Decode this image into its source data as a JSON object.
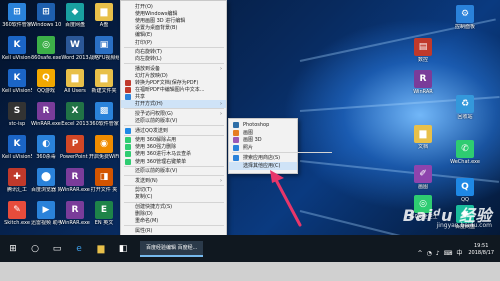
{
  "desktop_icons": [
    {
      "label": "360软件管家",
      "color": "#2a82da",
      "glyph": "⊞",
      "col": 0,
      "row": 0
    },
    {
      "label": "Windows 10",
      "color": "#1e5fae",
      "glyph": "⊞",
      "col": 1,
      "row": 0
    },
    {
      "label": "百度网盘",
      "color": "#19a0a0",
      "glyph": "◆",
      "col": 2,
      "row": 0
    },
    {
      "label": "A盘",
      "color": "#e8c04a",
      "glyph": "▆",
      "col": 3,
      "row": 0
    },
    {
      "label": "Keil uVision4",
      "color": "#1b65c6",
      "glyph": "K",
      "col": 0,
      "row": 1
    },
    {
      "label": "360safe.exe",
      "color": "#3cb048",
      "glyph": "◎",
      "col": 1,
      "row": 1
    },
    {
      "label": "Word 2013",
      "color": "#2b5797",
      "glyph": "W",
      "col": 2,
      "row": 1
    },
    {
      "label": "战略FU视频组件",
      "color": "#2a6fc4",
      "glyph": "▣",
      "col": 3,
      "row": 1
    },
    {
      "label": "Keil uVision5",
      "color": "#1b65c6",
      "glyph": "K",
      "col": 0,
      "row": 2
    },
    {
      "label": "QQ游戏",
      "color": "#f2a800",
      "glyph": "Q",
      "col": 1,
      "row": 2
    },
    {
      "label": "All Users",
      "color": "#e8c04a",
      "glyph": "▆",
      "col": 2,
      "row": 2
    },
    {
      "label": "新建文件夹",
      "color": "#e8c04a",
      "glyph": "▆",
      "col": 3,
      "row": 2
    },
    {
      "label": "stc-isp",
      "color": "#333",
      "glyph": "S",
      "col": 0,
      "row": 3
    },
    {
      "label": "WinRAR.exe 快捷方式",
      "color": "#7a3c9a",
      "glyph": "R",
      "col": 1,
      "row": 3
    },
    {
      "label": "Excel 2013",
      "color": "#217346",
      "glyph": "X",
      "col": 2,
      "row": 3
    },
    {
      "label": "360软件管家",
      "color": "#2a82da",
      "glyph": "▩",
      "col": 3,
      "row": 3
    },
    {
      "label": "Keil uVision5",
      "color": "#1b65c6",
      "glyph": "K",
      "col": 0,
      "row": 4
    },
    {
      "label": "360杀毒",
      "color": "#2a82da",
      "glyph": "◐",
      "col": 1,
      "row": 4
    },
    {
      "label": "PowerPoint 2013",
      "color": "#d24726",
      "glyph": "P",
      "col": 2,
      "row": 4
    },
    {
      "label": "开启免费WiFi",
      "color": "#f08c00",
      "glyph": "◉",
      "col": 3,
      "row": 4
    },
    {
      "label": "腾讯汇工",
      "color": "#c0392b",
      "glyph": "✚",
      "col": 0,
      "row": 5
    },
    {
      "label": "百度浏览器 好好工具",
      "color": "#2a82da",
      "glyph": "⬤",
      "col": 1,
      "row": 5
    },
    {
      "label": "WinRAR.exe 快捷方式",
      "color": "#7a3c9a",
      "glyph": "R",
      "col": 2,
      "row": 5
    },
    {
      "label": "打开文件 夹",
      "color": "#d35400",
      "glyph": "◨",
      "col": 3,
      "row": 5
    },
    {
      "label": "Skitch.exe",
      "color": "#e74c3c",
      "glyph": "✎",
      "col": 0,
      "row": 6
    },
    {
      "label": "迅雷视频 助手",
      "color": "#2a82da",
      "glyph": "▶",
      "col": 1,
      "row": 6
    },
    {
      "label": "WinRAR.exe 快捷方式",
      "color": "#7a3c9a",
      "glyph": "R",
      "col": 2,
      "row": 6
    },
    {
      "label": "EN 英文",
      "color": "#1e8449",
      "glyph": "E",
      "col": 3,
      "row": 6
    }
  ],
  "right_icons": [
    {
      "label": "控制面板",
      "color": "#2a82da",
      "glyph": "⚙",
      "pos": 0
    },
    {
      "label": "数控",
      "color": "#c0392b",
      "glyph": "▤",
      "pos": 1
    },
    {
      "label": "WinRAR",
      "color": "#7a3c9a",
      "glyph": "R",
      "pos": 2
    },
    {
      "label": "回收站",
      "color": "#3498db",
      "glyph": "♻",
      "pos": 3
    },
    {
      "label": "文档",
      "color": "#e8c04a",
      "glyph": "▆",
      "pos": 4
    },
    {
      "label": "WeChat.exe",
      "color": "#2ecc71",
      "glyph": "✆",
      "pos": 5
    },
    {
      "label": "画图",
      "color": "#8e44ad",
      "glyph": "✐",
      "pos": 6
    },
    {
      "label": "QQ",
      "color": "#1e88e5",
      "glyph": "Q",
      "pos": 7
    },
    {
      "label": "360安全卫士",
      "color": "#2ecc71",
      "glyph": "◎",
      "pos": 8
    },
    {
      "label": "百度网盘",
      "color": "#1abc9c",
      "glyph": "◆",
      "pos": 9
    }
  ],
  "context_menu": [
    {
      "type": "item",
      "label": "打开(O)",
      "icon_color": ""
    },
    {
      "type": "item",
      "label": "使用Windows编辑",
      "icon_color": ""
    },
    {
      "type": "item",
      "label": "使用画图 3D 进行编辑",
      "icon_color": ""
    },
    {
      "type": "item",
      "label": "设置为桌面背景(B)",
      "icon_color": ""
    },
    {
      "type": "item",
      "label": "编辑(E)",
      "icon_color": ""
    },
    {
      "type": "item",
      "label": "打印(P)",
      "icon_color": ""
    },
    {
      "type": "sep"
    },
    {
      "type": "item",
      "label": "向右旋转(T)",
      "icon_color": ""
    },
    {
      "type": "item",
      "label": "向左旋转(L)",
      "icon_color": ""
    },
    {
      "type": "sep"
    },
    {
      "type": "item",
      "label": "播放到设备",
      "icon_color": "",
      "submenu": true
    },
    {
      "type": "item",
      "label": "幻灯片放映(D)",
      "icon_color": ""
    },
    {
      "type": "item",
      "label": "转换为PDF文档(保存为PDF)",
      "icon_color": "#c0392b"
    },
    {
      "type": "item",
      "label": "在福昕PDF中编辑图片中文本...",
      "icon_color": "#c0392b"
    },
    {
      "type": "item",
      "label": "共享",
      "icon_color": "#2a82da"
    },
    {
      "type": "item",
      "label": "打开方式(H)",
      "icon_color": "",
      "submenu": true,
      "highlight": true
    },
    {
      "type": "sep"
    },
    {
      "type": "item",
      "label": "授予访问权限(G)",
      "icon_color": "",
      "submenu": true
    },
    {
      "type": "item",
      "label": "还原以前的版本(V)",
      "icon_color": ""
    },
    {
      "type": "sep"
    },
    {
      "type": "item",
      "label": "通过QQ发送到",
      "icon_color": "#1e88e5"
    },
    {
      "type": "sep"
    },
    {
      "type": "item",
      "label": "使用 360解除占用",
      "icon_color": "#2ecc71"
    },
    {
      "type": "item",
      "label": "使用 360强力删除",
      "icon_color": "#2ecc71"
    },
    {
      "type": "item",
      "label": "使用 360进行木马云查杀",
      "icon_color": "#2ecc71"
    },
    {
      "type": "item",
      "label": "使用 360管理右键菜单",
      "icon_color": "#2ecc71"
    },
    {
      "type": "sep"
    },
    {
      "type": "item",
      "label": "还原以前的版本(V)",
      "icon_color": ""
    },
    {
      "type": "sep"
    },
    {
      "type": "item",
      "label": "发送到(N)",
      "icon_color": "",
      "submenu": true
    },
    {
      "type": "sep"
    },
    {
      "type": "item",
      "label": "剪切(T)",
      "icon_color": ""
    },
    {
      "type": "item",
      "label": "复制(C)",
      "icon_color": ""
    },
    {
      "type": "sep"
    },
    {
      "type": "item",
      "label": "创建快捷方式(S)",
      "icon_color": ""
    },
    {
      "type": "item",
      "label": "删除(D)",
      "icon_color": ""
    },
    {
      "type": "item",
      "label": "重命名(M)",
      "icon_color": ""
    },
    {
      "type": "sep"
    },
    {
      "type": "item",
      "label": "属性(R)",
      "icon_color": ""
    }
  ],
  "submenu": [
    {
      "type": "item",
      "label": "Photoshop",
      "icon_color": "#2d6ea8"
    },
    {
      "type": "item",
      "label": "画图",
      "icon_color": "#e67e22"
    },
    {
      "type": "item",
      "label": "画图 3D",
      "icon_color": "#9b59b6"
    },
    {
      "type": "item",
      "label": "照片",
      "icon_color": "#2a82da"
    },
    {
      "type": "sep"
    },
    {
      "type": "item",
      "label": "搜索应用商店(S)",
      "icon_color": "#2a82da"
    },
    {
      "type": "item",
      "label": "选择其他应用(C)",
      "icon_color": "",
      "highlight": true
    }
  ],
  "taskbar": {
    "start_glyph": "⊞",
    "search_glyph": "○",
    "taskview_glyph": "▭",
    "edge_glyph": "e",
    "explorer_glyph": "▆",
    "store_glyph": "◧",
    "active_label": "百度经验编辑 百度经...",
    "time": "19:51",
    "date": "2018/8/17",
    "tray_icons": [
      "^",
      "◔",
      "♪",
      "⌨",
      "中"
    ]
  },
  "watermark": {
    "brand": "Bai⁠ᵈu 经验",
    "url": "jingyan.baidu.com"
  },
  "colors": {
    "accent": "#e8366a",
    "menu_bg": "#f2f2f2",
    "highlight": "#cfe3f7"
  }
}
